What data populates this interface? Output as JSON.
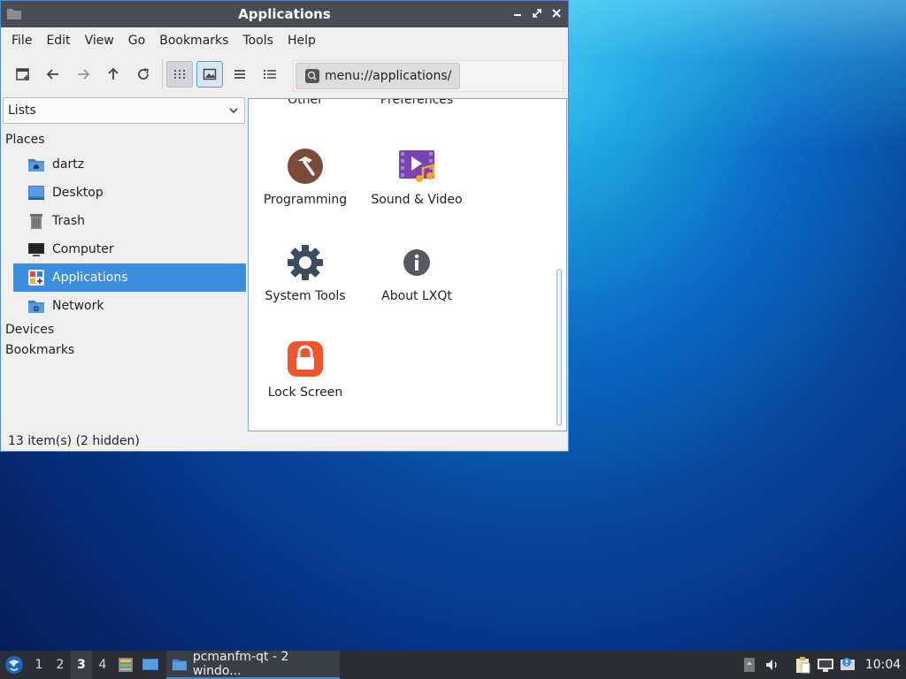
{
  "window": {
    "title": "Applications"
  },
  "menubar": {
    "items": [
      "File",
      "Edit",
      "View",
      "Go",
      "Bookmarks",
      "Tools",
      "Help"
    ]
  },
  "toolbar": {
    "address": "menu://applications/"
  },
  "sidebar": {
    "combo_value": "Lists",
    "places_heading": "Places",
    "places": [
      {
        "label": "dartz",
        "icon": "home-folder-icon"
      },
      {
        "label": "Desktop",
        "icon": "desktop-icon"
      },
      {
        "label": "Trash",
        "icon": "trash-icon"
      },
      {
        "label": "Computer",
        "icon": "computer-icon"
      },
      {
        "label": "Applications",
        "icon": "applications-icon",
        "selected": true
      },
      {
        "label": "Network",
        "icon": "network-icon"
      }
    ],
    "devices_heading": "Devices",
    "bookmarks_heading": "Bookmarks"
  },
  "content": {
    "partial_top": [
      "Other",
      "Preferences"
    ],
    "items": [
      {
        "label": "Programming",
        "icon": "programming-icon"
      },
      {
        "label": "Sound & Video",
        "icon": "sound-video-icon"
      },
      {
        "label": "System Tools",
        "icon": "system-tools-icon"
      },
      {
        "label": "About LXQt",
        "icon": "info-icon"
      },
      {
        "label": "Lock Screen",
        "icon": "lock-icon"
      }
    ]
  },
  "statusbar": {
    "text": "13 item(s) (2 hidden)"
  },
  "taskbar": {
    "workspaces": [
      "1",
      "2",
      "3",
      "4"
    ],
    "current_workspace": "3",
    "task_label": "pcmanfm-qt - 2 windo...",
    "clock": "10:04"
  },
  "colors": {
    "selection": "#3d8ee0",
    "titlebar": "#4a4e54",
    "taskbar": "#2b2f35"
  }
}
